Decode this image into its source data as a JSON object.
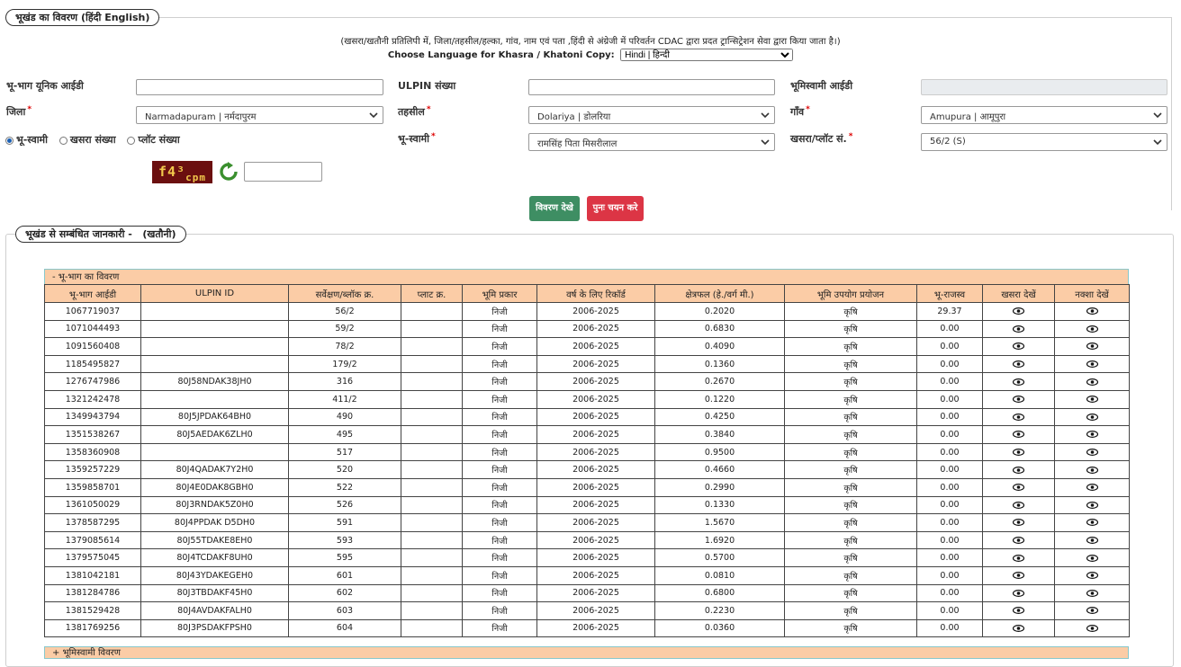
{
  "legend1": {
    "title": "भूखंड का विवरण",
    "lang_hindi": "हिंदी",
    "lang_english": "English"
  },
  "note": "(खसरा/खतौनी प्रतिलिपी में, जिला/तहसील/हल्का, गांव, नाम एवं पता ,हिंदी से अंग्रेजी में परिवर्तन CDAC द्वारा प्रदत ट्रान्सिट्रेशन सेवा द्वारा किया जाता है।)",
  "language": {
    "label": "Choose Language for Khasra / Khatoni Copy:",
    "selected": "Hindi | हिन्दी"
  },
  "form": {
    "unique_id_label": "भू-भाग यूनिक आईडी",
    "ulpin_label": "ULPIN संख्या",
    "owner_id_label": "भूमिस्वामी आईडी",
    "district_label": "जिला",
    "district_value": "Narmadapuram | नर्मदापुरम",
    "tehsil_label": "तहसील",
    "tehsil_value": "Dolariya | डोलरिया",
    "village_label": "गाँव",
    "village_value": "Amupura | आमूपुरा",
    "radio_owner": "भू-स्वामी",
    "radio_khasra": "खसरा संख्या",
    "radio_plot": "प्लॉट संख्या",
    "owner_label": "भू-स्वामी",
    "owner_value": "रामसिंह पिता मिसरीलाल",
    "khasra_label": "खसरा/प्लॉट सं.",
    "khasra_value": "56/2 (S)",
    "captcha_main": "f4³",
    "captcha_sub": "cpm"
  },
  "buttons": {
    "view": "विवरण देखे",
    "reset": "पुनः चयन करे"
  },
  "legend2": {
    "title": "भूखंड से सम्बंधित जानकारी -",
    "sub": "(खतौनी)"
  },
  "table": {
    "caption": "- भू-भाग का विवरण",
    "headers": [
      "भू-भाग आईडी",
      "ULPIN ID",
      "सर्वेक्षण/ब्लॉक क्र.",
      "प्लाट क्र.",
      "भूमि प्रकार",
      "वर्ष के लिए रिकॉर्ड",
      "क्षेत्रफल (हे./वर्ग मी.)",
      "भूमि उपयोग प्रयोजन",
      "भू-राजस्व",
      "खसरा देखें",
      "नक्शा देखें"
    ],
    "rows": [
      [
        "1067719037",
        "",
        "56/2",
        "",
        "निजी",
        "2006-2025",
        "0.2020",
        "कृषि",
        "29.37"
      ],
      [
        "1071044493",
        "",
        "59/2",
        "",
        "निजी",
        "2006-2025",
        "0.6830",
        "कृषि",
        "0.00"
      ],
      [
        "1091560408",
        "",
        "78/2",
        "",
        "निजी",
        "2006-2025",
        "0.4090",
        "कृषि",
        "0.00"
      ],
      [
        "1185495827",
        "",
        "179/2",
        "",
        "निजी",
        "2006-2025",
        "0.1360",
        "कृषि",
        "0.00"
      ],
      [
        "1276747986",
        "80J58NDAK38JH0",
        "316",
        "",
        "निजी",
        "2006-2025",
        "0.2670",
        "कृषि",
        "0.00"
      ],
      [
        "1321242478",
        "",
        "411/2",
        "",
        "निजी",
        "2006-2025",
        "0.1220",
        "कृषि",
        "0.00"
      ],
      [
        "1349943794",
        "80J5JPDAK64BH0",
        "490",
        "",
        "निजी",
        "2006-2025",
        "0.4250",
        "कृषि",
        "0.00"
      ],
      [
        "1351538267",
        "80J5AEDAK6ZLH0",
        "495",
        "",
        "निजी",
        "2006-2025",
        "0.3840",
        "कृषि",
        "0.00"
      ],
      [
        "1358360908",
        "",
        "517",
        "",
        "निजी",
        "2006-2025",
        "0.9500",
        "कृषि",
        "0.00"
      ],
      [
        "1359257229",
        "80J4QADAK7Y2H0",
        "520",
        "",
        "निजी",
        "2006-2025",
        "0.4660",
        "कृषि",
        "0.00"
      ],
      [
        "1359858701",
        "80J4E0DAK8GBH0",
        "522",
        "",
        "निजी",
        "2006-2025",
        "0.2990",
        "कृषि",
        "0.00"
      ],
      [
        "1361050029",
        "80J3RNDAK5Z0H0",
        "526",
        "",
        "निजी",
        "2006-2025",
        "0.1330",
        "कृषि",
        "0.00"
      ],
      [
        "1378587295",
        "80J4PPDAK D5DH0",
        "591",
        "",
        "निजी",
        "2006-2025",
        "1.5670",
        "कृषि",
        "0.00"
      ],
      [
        "1379085614",
        "80J55TDAKE8EH0",
        "593",
        "",
        "निजी",
        "2006-2025",
        "1.6920",
        "कृषि",
        "0.00"
      ],
      [
        "1379575045",
        "80J4TCDAKF8UH0",
        "595",
        "",
        "निजी",
        "2006-2025",
        "0.5700",
        "कृषि",
        "0.00"
      ],
      [
        "1381042181",
        "80J43YDAKEGEH0",
        "601",
        "",
        "निजी",
        "2006-2025",
        "0.0810",
        "कृषि",
        "0.00"
      ],
      [
        "1381284786",
        "80J3TBDAKF45H0",
        "602",
        "",
        "निजी",
        "2006-2025",
        "0.6800",
        "कृषि",
        "0.00"
      ],
      [
        "1381529428",
        "80J4AVDAKFALH0",
        "603",
        "",
        "निजी",
        "2006-2025",
        "0.2230",
        "कृषि",
        "0.00"
      ],
      [
        "1381769256",
        "80J3PSDAKFPSH0",
        "604",
        "",
        "निजी",
        "2006-2025",
        "0.0360",
        "कृषि",
        "0.00"
      ]
    ]
  },
  "caption2": "+ भूमिस्वामी विवरण",
  "icons": {
    "view_khasra": "eye-icon",
    "view_map": "eye-icon",
    "refresh": "refresh-icon",
    "dropdown": "chevron-down-icon"
  },
  "colors": {
    "header_bg": "#fbcca6",
    "green_button": "#3e8e63",
    "red_button": "#dc3545",
    "captcha_bg": "#6b0f0f"
  }
}
